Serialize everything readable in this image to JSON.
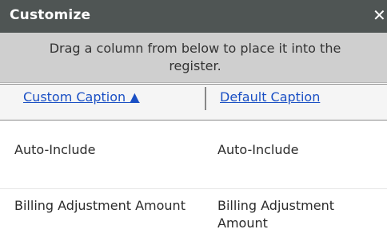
{
  "dialog": {
    "title": "Customize",
    "close_glyph": "✕",
    "instructions_line1": "Drag a column from below to place it into the",
    "instructions_line2": "register."
  },
  "columns": {
    "custom_caption": "Custom Caption ▲",
    "default_caption": "Default Caption"
  },
  "rows": [
    {
      "custom": "Auto-Include",
      "default": "Auto-Include"
    },
    {
      "custom": "Billing Adjustment Amount",
      "default": "Billing Adjustment Amount"
    }
  ],
  "colors": {
    "titlebar": "#4f5554",
    "instruction_bg": "#cfcfcf",
    "link": "#1a4fc4"
  }
}
